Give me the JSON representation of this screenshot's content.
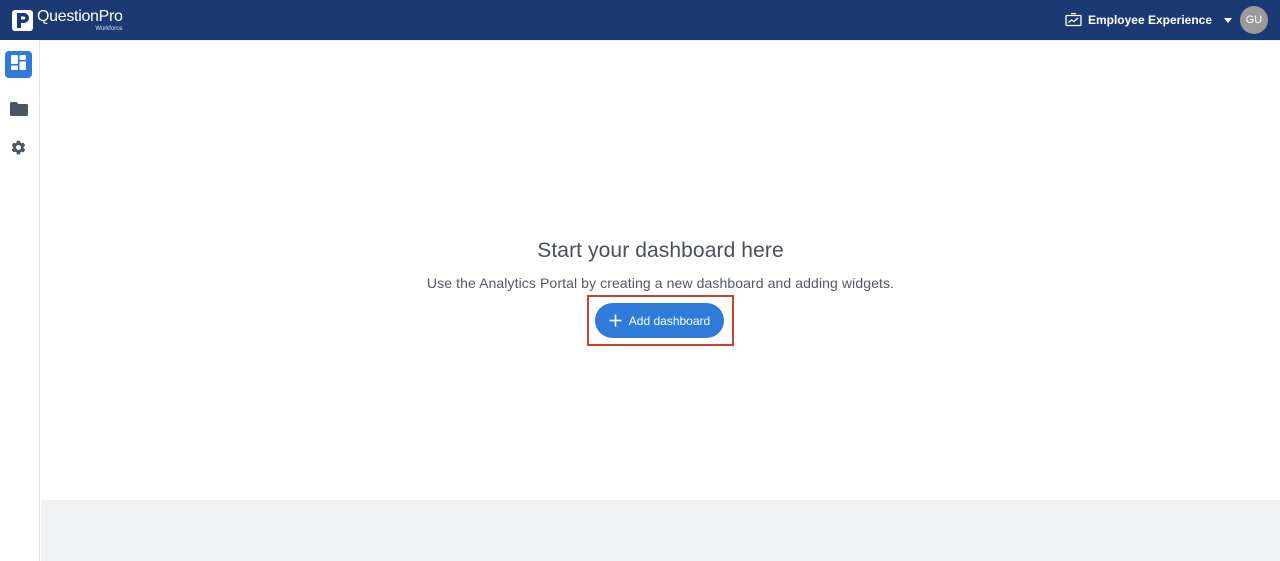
{
  "brand": {
    "name": "QuestionPro",
    "sub": "Workforce",
    "logo_letter": "P"
  },
  "header": {
    "product_label": "Employee Experience",
    "product_icon": "presentation-chart-icon",
    "avatar_initials": "GU"
  },
  "sidebar": {
    "items": [
      {
        "name": "dashboard",
        "icon": "dashboard-icon",
        "active": true
      },
      {
        "name": "folders",
        "icon": "folder-icon",
        "active": false
      },
      {
        "name": "settings",
        "icon": "gear-icon",
        "active": false
      }
    ]
  },
  "empty_state": {
    "title": "Start your dashboard here",
    "subtitle": "Use the Analytics Portal by creating a new dashboard and adding widgets.",
    "button_label": "Add dashboard"
  },
  "colors": {
    "topbar": "#1b3a73",
    "accent": "#2f7bd9",
    "highlight_border": "#c8432e"
  }
}
